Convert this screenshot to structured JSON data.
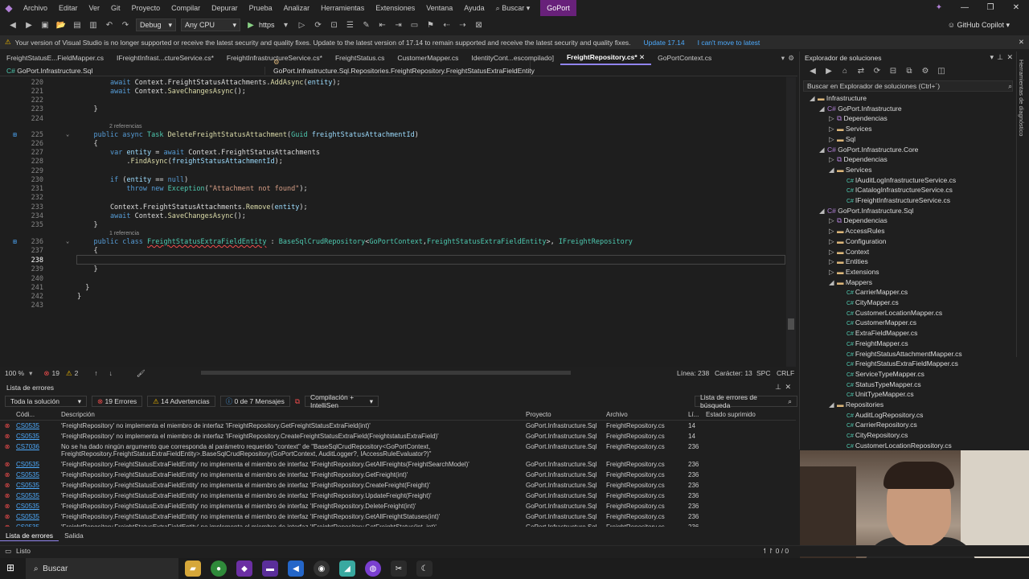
{
  "menubar": {
    "items": [
      "Archivo",
      "Editar",
      "Ver",
      "Git",
      "Proyecto",
      "Compilar",
      "Depurar",
      "Prueba",
      "Analizar",
      "Herramientas",
      "Extensiones",
      "Ventana",
      "Ayuda"
    ],
    "search": "Buscar",
    "project": "GoPort"
  },
  "toolbar": {
    "config": "Debug",
    "platform": "Any CPU",
    "run_target": "https",
    "copilot": "GitHub Copilot"
  },
  "infobar": {
    "message": "Your version of Visual Studio is no longer supported or receive the latest security and quality fixes. Update to the latest version of 17.14 to remain supported and receive the latest security and quality fixes.",
    "update": "Update 17.14",
    "cant_move": "I can't move to latest"
  },
  "tabs": [
    "FreightStatusE...FieldMapper.cs",
    "IFreightInfrast...ctureService.cs*",
    "FreightInfrastructureService.cs*",
    "FreightStatus.cs",
    "CustomerMapper.cs",
    "IdentityCont...escompilado]",
    "FreightRepository.cs*",
    "GoPortContext.cs"
  ],
  "active_tab": "FreightRepository.cs*",
  "breadcrumbs": {
    "project": "GoPort.Infrastructure.Sql",
    "namespace": "GoPort.Infrastructure.Sql.Repositories.FreightRepository.FreightStatusExtraFieldEntity",
    "member": ""
  },
  "editor": {
    "lines": [
      "220",
      "221",
      "222",
      "223",
      "224",
      "225",
      "226",
      "227",
      "228",
      "229",
      "230",
      "231",
      "232",
      "233",
      "234",
      "235",
      "236",
      "237",
      "238",
      "239",
      "240",
      "241",
      "242",
      "243"
    ],
    "refs": {
      "r225": "2 referencias",
      "r236": "1 referencia"
    }
  },
  "editor_status": {
    "zoom": "100 %",
    "errors": "19",
    "warnings": "2",
    "line": "Línea: 238",
    "char": "Carácter: 13",
    "spc": "SPC",
    "crlf": "CRLF"
  },
  "error_list": {
    "title": "Lista de errores",
    "scope": "Toda la solución",
    "errors_btn": "19 Errores",
    "warnings_btn": "14 Advertencias",
    "messages_btn": "0 de 7 Mensajes",
    "build_filter": "Compilación + IntelliSen",
    "search": "Lista de errores de búsqueda",
    "headers": [
      "Códi...",
      "Descripción",
      "Proyecto",
      "Archivo",
      "Lí...",
      "Estado suprimido"
    ],
    "rows": [
      {
        "code": "CS0535",
        "desc": "'FreightRepository' no implementa el miembro de interfaz 'IFreightRepository.GetFreightStatusExtraField(int)'",
        "proj": "GoPort.Infrastructure.Sql",
        "file": "FreightRepository.cs",
        "line": "14"
      },
      {
        "code": "CS0535",
        "desc": "'FreightRepository' no implementa el miembro de interfaz 'IFreightRepository.CreateFreightStatusExtraField(FreightstatusExtraField)'",
        "proj": "GoPort.Infrastructure.Sql",
        "file": "FreightRepository.cs",
        "line": "14"
      },
      {
        "code": "CS7036",
        "desc": "No se ha dado ningún argumento que corresponda al parámetro requerido \"context\" de \"BaseSqlCrudRepository<GoPortContext,",
        "desc2": "FreightRepository.FreightStatusExtraFieldEntity>.BaseSqlCrudRepository(GoPortContext, AuditLogger?, IAccessRuleEvaluator?)\"",
        "proj": "GoPort.Infrastructure.Sql",
        "file": "FreightRepository.cs",
        "line": "236"
      },
      {
        "code": "CS0535",
        "desc": "'FreightRepository.FreightStatusExtraFieldEntity' no implementa el miembro de interfaz 'IFreightRepository.GetAllFreights(FreightSearchModel)'",
        "proj": "GoPort.Infrastructure.Sql",
        "file": "FreightRepository.cs",
        "line": "236"
      },
      {
        "code": "CS0535",
        "desc": "'FreightRepository.FreightStatusExtraFieldEntity' no implementa el miembro de interfaz 'IFreightRepository.GetFreight(int)'",
        "proj": "GoPort.Infrastructure.Sql",
        "file": "FreightRepository.cs",
        "line": "236"
      },
      {
        "code": "CS0535",
        "desc": "'FreightRepository.FreightStatusExtraFieldEntity' no implementa el miembro de interfaz 'IFreightRepository.CreateFreight(Freight)'",
        "proj": "GoPort.Infrastructure.Sql",
        "file": "FreightRepository.cs",
        "line": "236"
      },
      {
        "code": "CS0535",
        "desc": "'FreightRepository.FreightStatusExtraFieldEntity' no implementa el miembro de interfaz 'IFreightRepository.UpdateFreight(Freight)'",
        "proj": "GoPort.Infrastructure.Sql",
        "file": "FreightRepository.cs",
        "line": "236"
      },
      {
        "code": "CS0535",
        "desc": "'FreightRepository.FreightStatusExtraFieldEntity' no implementa el miembro de interfaz 'IFreightRepository.DeleteFreight(int)'",
        "proj": "GoPort.Infrastructure.Sql",
        "file": "FreightRepository.cs",
        "line": "236"
      },
      {
        "code": "CS0535",
        "desc": "'FreightRepository.FreightStatusExtraFieldEntity' no implementa el miembro de interfaz 'IFreightRepository.GetAllFreightStatuses(int)'",
        "proj": "GoPort.Infrastructure.Sql",
        "file": "FreightRepository.cs",
        "line": "236"
      },
      {
        "code": "CS0535",
        "desc": "'FreightRepository.FreightStatusExtraFieldEntity' no implementa el miembro de interfaz 'IFreightRepository.GetFreightStatus(int, int)'",
        "proj": "GoPort.Infrastructure.Sql",
        "file": "FreightRepository.cs",
        "line": "236"
      }
    ],
    "bottom_tabs": [
      "Lista de errores",
      "Salida"
    ]
  },
  "solution": {
    "title": "Explorador de soluciones",
    "search": "Buscar en Explorador de soluciones (Ctrl+´)",
    "nodes": [
      {
        "label": "Infrastructure",
        "depth": 0,
        "kind": "folder",
        "open": true
      },
      {
        "label": "GoPort.Infrastructure",
        "depth": 1,
        "kind": "project",
        "open": true
      },
      {
        "label": "Dependencias",
        "depth": 2,
        "kind": "deps",
        "open": false
      },
      {
        "label": "Services",
        "depth": 2,
        "kind": "folder",
        "open": false
      },
      {
        "label": "Sql",
        "depth": 2,
        "kind": "folder",
        "open": false
      },
      {
        "label": "GoPort.Infrastructure.Core",
        "depth": 1,
        "kind": "project",
        "open": true
      },
      {
        "label": "Dependencias",
        "depth": 2,
        "kind": "deps",
        "open": false
      },
      {
        "label": "Services",
        "depth": 2,
        "kind": "folder",
        "open": true
      },
      {
        "label": "IAuditLogInfrastructureService.cs",
        "depth": 3,
        "kind": "cs",
        "open": false
      },
      {
        "label": "ICatalogInfrastructureService.cs",
        "depth": 3,
        "kind": "cs",
        "open": false
      },
      {
        "label": "IFreightInfrastructureService.cs",
        "depth": 3,
        "kind": "cs",
        "open": false
      },
      {
        "label": "GoPort.Infrastructure.Sql",
        "depth": 1,
        "kind": "project",
        "open": true
      },
      {
        "label": "Dependencias",
        "depth": 2,
        "kind": "deps",
        "open": false
      },
      {
        "label": "AccessRules",
        "depth": 2,
        "kind": "folder",
        "open": false
      },
      {
        "label": "Configuration",
        "depth": 2,
        "kind": "folder",
        "open": false
      },
      {
        "label": "Context",
        "depth": 2,
        "kind": "folder",
        "open": false
      },
      {
        "label": "Entities",
        "depth": 2,
        "kind": "folder",
        "open": false
      },
      {
        "label": "Extensions",
        "depth": 2,
        "kind": "folder",
        "open": false
      },
      {
        "label": "Mappers",
        "depth": 2,
        "kind": "folder",
        "open": true
      },
      {
        "label": "CarrierMapper.cs",
        "depth": 3,
        "kind": "cs",
        "open": false
      },
      {
        "label": "CityMapper.cs",
        "depth": 3,
        "kind": "cs",
        "open": false
      },
      {
        "label": "CustomerLocationMapper.cs",
        "depth": 3,
        "kind": "cs",
        "open": false
      },
      {
        "label": "CustomerMapper.cs",
        "depth": 3,
        "kind": "cs",
        "open": false
      },
      {
        "label": "ExtraFieldMapper.cs",
        "depth": 3,
        "kind": "cs",
        "open": false
      },
      {
        "label": "FreightMapper.cs",
        "depth": 3,
        "kind": "cs",
        "open": false
      },
      {
        "label": "FreightStatusAttachmentMapper.cs",
        "depth": 3,
        "kind": "cs",
        "open": false
      },
      {
        "label": "FreightStatusExtraFieldMapper.cs",
        "depth": 3,
        "kind": "cs",
        "open": false
      },
      {
        "label": "ServiceTypeMapper.cs",
        "depth": 3,
        "kind": "cs",
        "open": false
      },
      {
        "label": "StatusTypeMapper.cs",
        "depth": 3,
        "kind": "cs",
        "open": false
      },
      {
        "label": "UnitTypeMapper.cs",
        "depth": 3,
        "kind": "cs",
        "open": false
      },
      {
        "label": "Repositories",
        "depth": 2,
        "kind": "folder",
        "open": true
      },
      {
        "label": "AuditLogRepository.cs",
        "depth": 3,
        "kind": "cs",
        "open": false
      },
      {
        "label": "CarrierRepository.cs",
        "depth": 3,
        "kind": "cs",
        "open": false
      },
      {
        "label": "CityRepository.cs",
        "depth": 3,
        "kind": "cs",
        "open": false
      },
      {
        "label": "CustomerLocationRepository.cs",
        "depth": 3,
        "kind": "cs",
        "open": false
      }
    ]
  },
  "right_strip": "Herramientas de diagnóstico",
  "statusbar": {
    "ready": "Listo",
    "pos": "↿↾ 0 / 0"
  },
  "taskbar": {
    "search": "Buscar"
  }
}
